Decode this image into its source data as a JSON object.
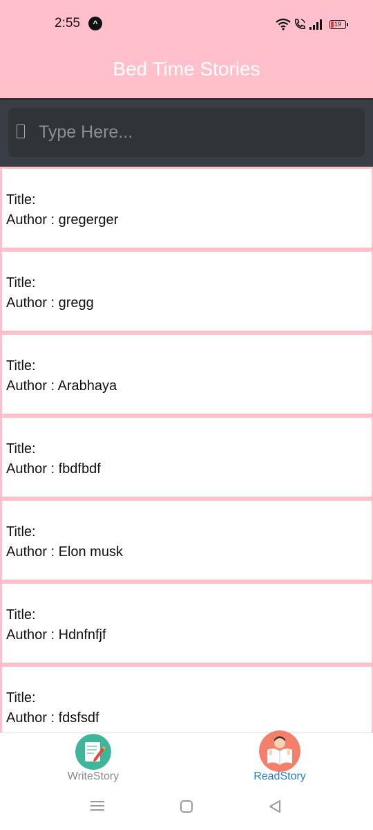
{
  "status_bar": {
    "time": "2:55",
    "app_icon": "expo-icon",
    "icons": [
      "wifi-icon",
      "call-icon",
      "signal-icon",
      "battery-icon"
    ],
    "battery_level": "19"
  },
  "header": {
    "title": "Bed Time Stories"
  },
  "search": {
    "placeholder": "Type Here..."
  },
  "stories": [
    {
      "title_label": "Title:",
      "author_label": "Author : gregerger"
    },
    {
      "title_label": "Title:",
      "author_label": "Author : gregg"
    },
    {
      "title_label": "Title:",
      "author_label": "Author : Arabhaya"
    },
    {
      "title_label": "Title:",
      "author_label": "Author : fbdfbdf"
    },
    {
      "title_label": "Title:",
      "author_label": "Author : Elon musk"
    },
    {
      "title_label": "Title:",
      "author_label": "Author : Hdnfnfjf"
    },
    {
      "title_label": "Title:",
      "author_label": "Author : fdsfsdf"
    }
  ],
  "bottom_nav": {
    "items": [
      {
        "label": "WriteStory",
        "icon": "write-story-icon",
        "active": false
      },
      {
        "label": "ReadStory",
        "icon": "read-story-icon",
        "active": true
      }
    ]
  },
  "system_nav": {
    "icons": [
      "menu-icon",
      "home-icon",
      "back-icon"
    ]
  },
  "colors": {
    "header_bg": "#ffc0cb",
    "search_bg": "#393e46",
    "active_tab": "#1e7fd4",
    "inactive_tab": "#8a8a8a"
  }
}
